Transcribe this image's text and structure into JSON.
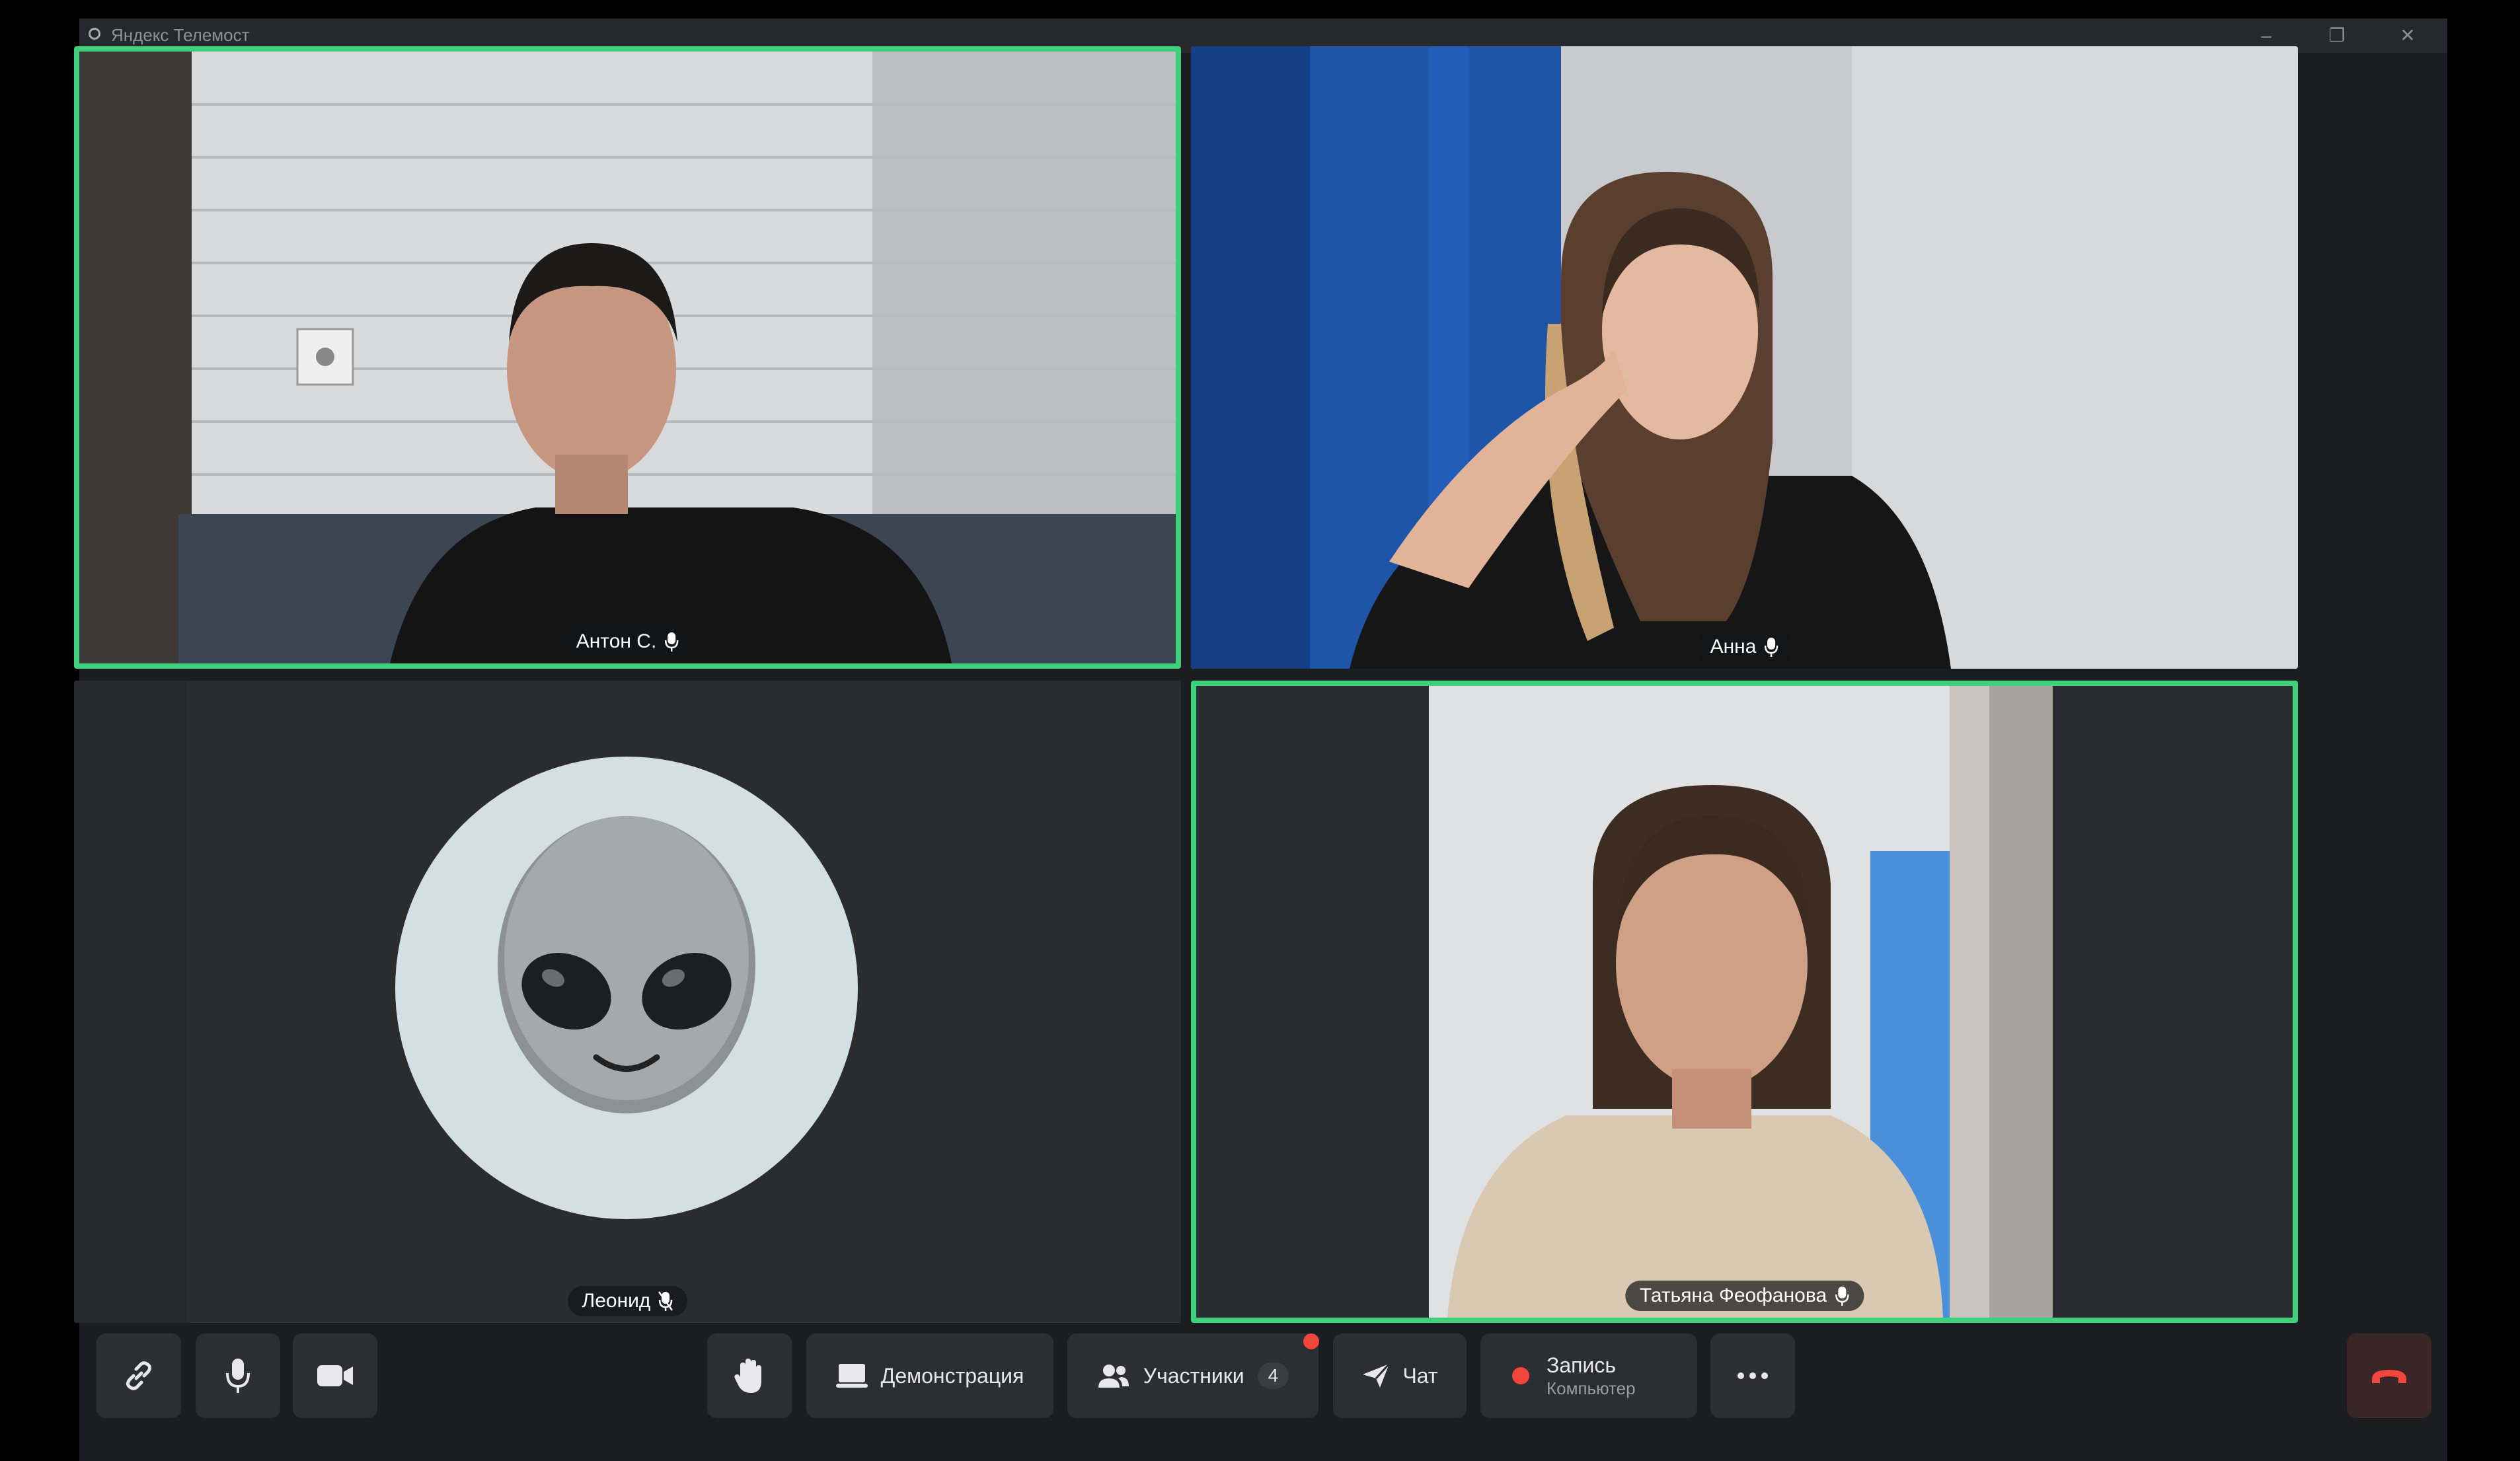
{
  "window": {
    "title": "Яндекс Телемост",
    "controls": [
      "minimize-icon",
      "maximize-icon",
      "close-icon"
    ]
  },
  "participants": [
    {
      "name": "Антон С.",
      "mic": "on",
      "speaking": true,
      "video": true
    },
    {
      "name": "Анна",
      "mic": "on",
      "speaking": false,
      "video": true
    },
    {
      "name": "Леонид",
      "mic": "muted",
      "speaking": false,
      "video": false,
      "avatar": "alien-emoji"
    },
    {
      "name": "Татьяна Феофанова",
      "mic": "on",
      "speaking": true,
      "video": true
    }
  ],
  "toolbar": {
    "link_icon": "link-icon",
    "mic_icon": "microphone-icon",
    "camera_icon": "camera-icon",
    "hand_icon": "raise-hand-icon",
    "demo_label": "Демонстрация",
    "participants_label": "Участники",
    "participants_count": "4",
    "chat_label": "Чат",
    "record_label": "Запись",
    "record_sub": "Компьютер",
    "more_icon": "more-icon",
    "end_icon": "end-call-icon"
  },
  "colors": {
    "speaking_border": "#3ed07b",
    "record_dot": "#f0463c",
    "end_call": "#f0463c",
    "background": "#1c1d20"
  }
}
